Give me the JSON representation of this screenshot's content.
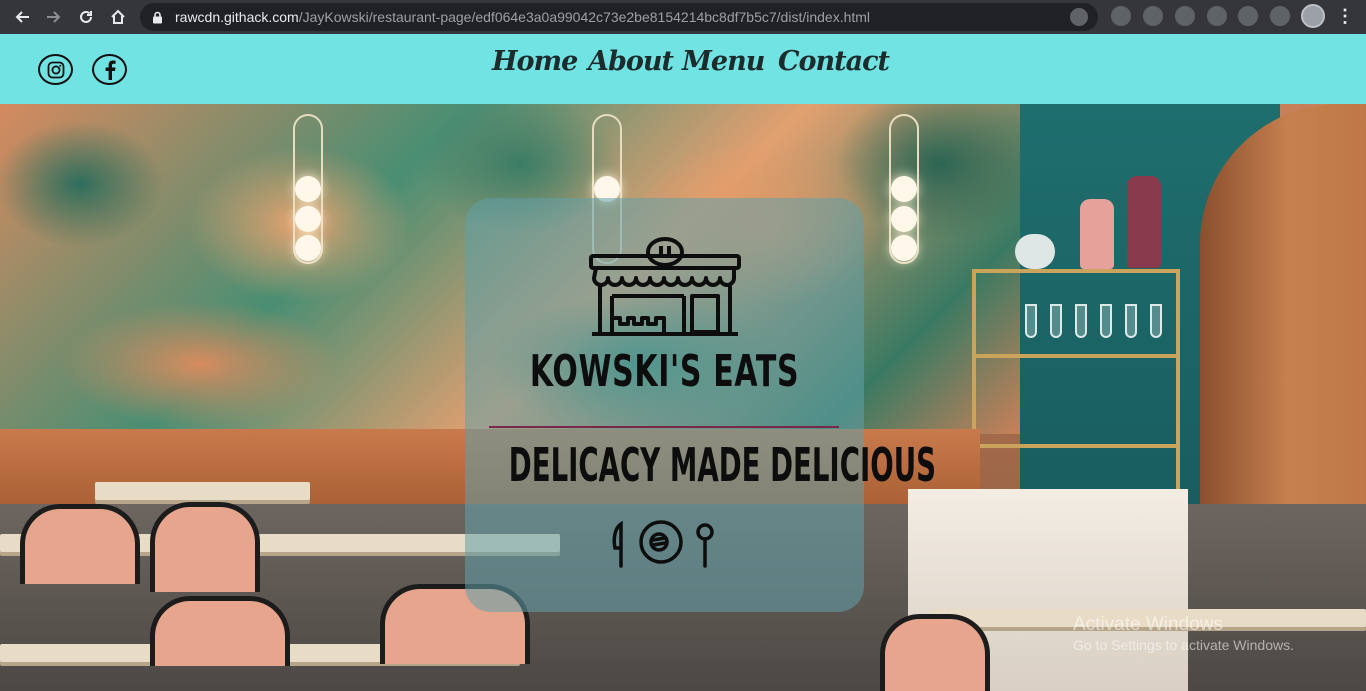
{
  "browser": {
    "url_host": "rawcdn.githack.com",
    "url_path": "/JayKowski/restaurant-page/edf064e3a0a99042c73e2be8154214bc8df7b5c7/dist/index.html"
  },
  "header": {
    "social": [
      {
        "icon": "instagram-icon"
      },
      {
        "icon": "facebook-icon"
      }
    ],
    "nav": [
      "Home",
      "About",
      "Menu",
      "Contact"
    ]
  },
  "hero": {
    "brand": "KOWSKI'S EATS",
    "tagline": "DELICACY MADE DELICIOUS",
    "logo_icon": "storefront-icon",
    "food_icons": [
      "knife-icon",
      "plate-icon",
      "spoon-icon"
    ]
  },
  "watermark": {
    "title": "Activate Windows",
    "subtitle": "Go to Settings to activate Windows."
  },
  "colors": {
    "header_bg": "#72e3e3",
    "card_bg": "rgba(96,160,170,0.55)",
    "divider": "#7a2848"
  }
}
